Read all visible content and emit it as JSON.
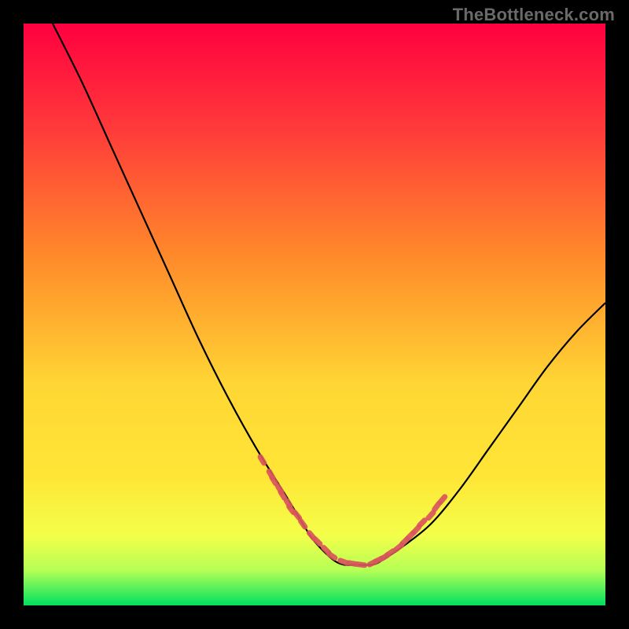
{
  "watermark": "TheBottleneck.com",
  "chart_data": {
    "type": "line",
    "title": "",
    "xlabel": "",
    "ylabel": "",
    "xlim": [
      0,
      100
    ],
    "ylim": [
      0,
      100
    ],
    "background_gradient": {
      "top": "#ff0040",
      "mid_upper": "#ff8a2a",
      "mid": "#ffe636",
      "mid_lower": "#f3ff4a",
      "bottom": "#00e060"
    },
    "series": [
      {
        "name": "curve",
        "color": "#000000",
        "x": [
          5,
          10,
          15,
          20,
          25,
          30,
          35,
          40,
          45,
          48,
          50,
          53,
          55,
          57,
          60,
          62,
          65,
          70,
          75,
          80,
          85,
          90,
          95,
          100
        ],
        "y": [
          100,
          90,
          79,
          68,
          57,
          46,
          36,
          27,
          19,
          14,
          11,
          8,
          7,
          7,
          7,
          8,
          10,
          14,
          20,
          27,
          34,
          41,
          47,
          52
        ]
      },
      {
        "name": "highlight-dots-left",
        "color": "#d9555c",
        "x": [
          41,
          42.5,
          43,
          44,
          44.5,
          45.5,
          46,
          47,
          48,
          49.5,
          50.5,
          52,
          53,
          55,
          56.5,
          58
        ],
        "y": [
          25,
          22.5,
          21.5,
          20,
          19,
          17.5,
          16.5,
          15.5,
          14,
          12,
          11,
          9.5,
          8.5,
          7.5,
          7.2,
          7
        ]
      },
      {
        "name": "highlight-dots-right",
        "color": "#d9555c",
        "x": [
          60,
          61,
          62,
          63,
          64.5,
          65.5,
          66.5,
          67.5,
          68.5,
          70,
          71,
          72
        ],
        "y": [
          7.3,
          7.8,
          8.3,
          9,
          10,
          11,
          12,
          13,
          14.2,
          15.5,
          17,
          18.2
        ]
      }
    ]
  }
}
